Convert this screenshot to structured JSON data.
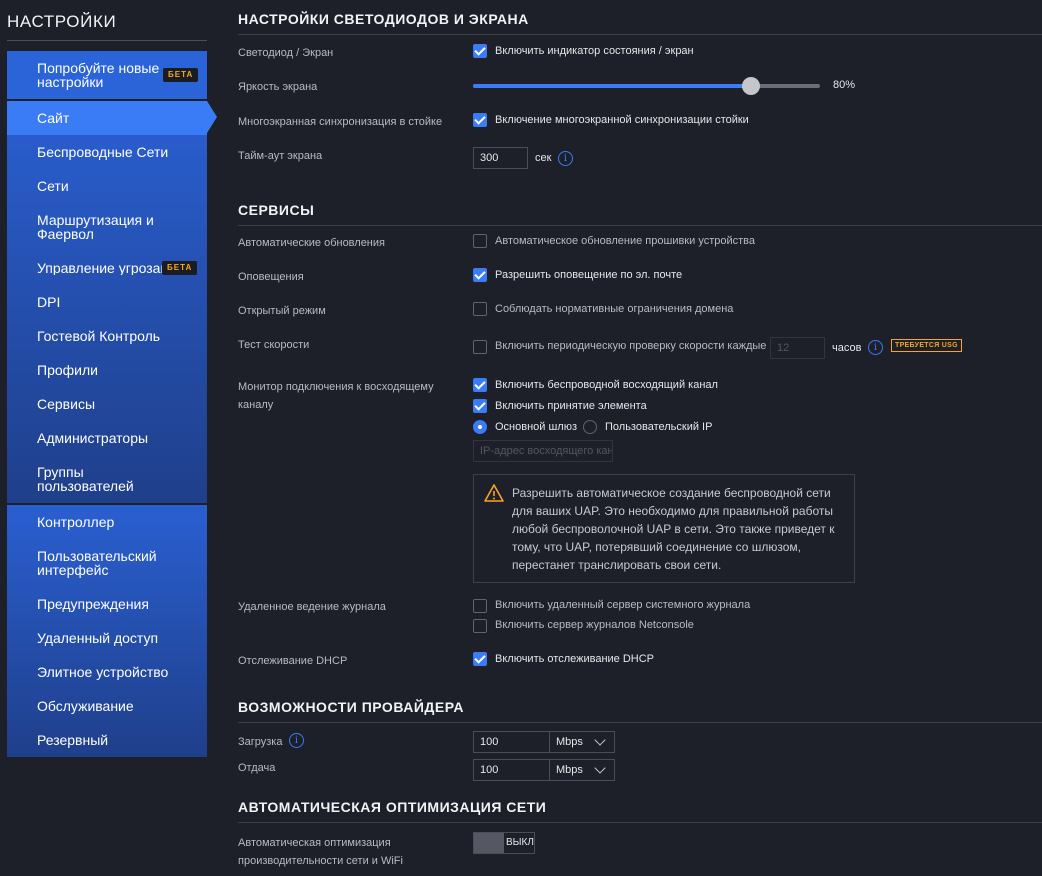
{
  "sidebar": {
    "title": "НАСТРОЙКИ",
    "try_new": {
      "label": "Попробуйте новые настройки",
      "badge": "БЕТА"
    },
    "items": [
      {
        "label": "Сайт",
        "active": true
      },
      {
        "label": "Беспроводные Сети"
      },
      {
        "label": "Сети"
      },
      {
        "label": "Маршрутизация и Фаервол"
      },
      {
        "label": "Управление угрозами",
        "badge": "БЕТА"
      },
      {
        "label": "DPI"
      },
      {
        "label": "Гостевой Контроль"
      },
      {
        "label": "Профили"
      },
      {
        "label": "Сервисы"
      },
      {
        "label": "Администраторы"
      },
      {
        "label": "Группы пользователей"
      }
    ],
    "items2": [
      {
        "label": "Контроллер"
      },
      {
        "label": "Пользовательский интерфейс"
      },
      {
        "label": "Предупреждения"
      },
      {
        "label": "Удаленный доступ"
      },
      {
        "label": "Элитное устройство"
      },
      {
        "label": "Обслуживание"
      },
      {
        "label": "Резервный"
      }
    ]
  },
  "led_section": {
    "title": "НАСТРОЙКИ СВЕТОДИОДОВ И ЭКРАНА",
    "led_label": "Светодиод / Экран",
    "led_option": "Включить индикатор состояния / экран",
    "brightness_label": "Яркость экрана",
    "brightness_value": "80%",
    "brightness_fraction": 0.8,
    "sync_label": "Многоэкранная синхронизация в стойке",
    "sync_option": "Включение многоэкранной синхронизации стойки",
    "timeout_label": "Тайм-аут экрана",
    "timeout_value": "300",
    "timeout_unit": "сек"
  },
  "services": {
    "title": "СЕРВИСЫ",
    "auto_update_label": "Автоматические обновления",
    "auto_update_option": "Автоматическое обновление прошивки устройства",
    "notify_label": "Оповещения",
    "notify_option": "Разрешить оповещение по эл. почте",
    "open_mode_label": "Открытый режим",
    "open_mode_option": "Соблюдать нормативные ограничения домена",
    "speed_label": "Тест скорости",
    "speed_option": "Включить периодическую проверку скорости каждые",
    "speed_value": "12",
    "speed_unit": "часов",
    "usg_badge": "ТРЕБУЕТСЯ USG",
    "uplink_label": "Монитор подключения к восходящему каналу",
    "uplink_option1": "Включить беспроводной восходящий канал",
    "uplink_option2": "Включить принятие элемента",
    "radio_gateway": "Основной шлюз",
    "radio_custom": "Пользовательский IP",
    "uplink_ip_placeholder": "IP-адрес восходящего канала",
    "warning_text": "Разрешить автоматическое создание беспроводной сети для ваших UAP. Это необходимо для правильной работы любой беспроволочной UAP в сети. Это также приведет к тому, что UAP, потерявший соединение со шлюзом, перестанет транслировать свои сети.",
    "syslog_label": "Удаленное ведение журнала",
    "syslog_option1": "Включить удаленный сервер системного журнала",
    "syslog_option2": "Включить сервер журналов Netconsole",
    "dhcp_label": "Отслеживание DHCP",
    "dhcp_option": "Включить отслеживание DHCP"
  },
  "isp": {
    "title": "ВОЗМОЖНОСТИ ПРОВАЙДЕРА",
    "download_label": "Загрузка",
    "download_value": "100",
    "download_unit": "Mbps",
    "upload_label": "Отдача",
    "upload_value": "100",
    "upload_unit": "Mbps"
  },
  "optimize": {
    "title": "АВТОМАТИЧЕСКАЯ ОПТИМИЗАЦИЯ СЕТИ",
    "label": "Автоматическая оптимизация производительности сети и WiFi",
    "toggle_label": "ВЫКЛ"
  },
  "colors": {
    "accent": "#3a7cf5",
    "sidebar": "#2a5fd1",
    "badge": "#f6a623",
    "bg": "#1d1f29"
  }
}
